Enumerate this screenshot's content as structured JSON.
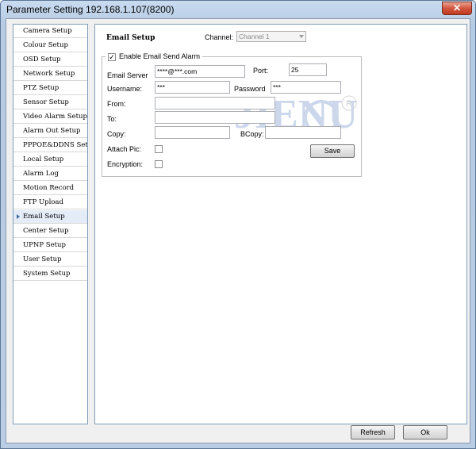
{
  "window": {
    "title": "Parameter Setting 192.168.1.107(8200)",
    "close_glyph": "✕"
  },
  "sidebar": {
    "items": [
      {
        "label": "Camera Setup"
      },
      {
        "label": "Colour Setup"
      },
      {
        "label": "OSD Setup"
      },
      {
        "label": "Network Setup"
      },
      {
        "label": "PTZ Setup"
      },
      {
        "label": "Sensor Setup"
      },
      {
        "label": "Video Alarm Setup"
      },
      {
        "label": "Alarm Out Setup"
      },
      {
        "label": "PPPOE&DDNS Setup"
      },
      {
        "label": "Local Setup"
      },
      {
        "label": "Alarm Log"
      },
      {
        "label": "Motion Record"
      },
      {
        "label": "FTP Upload"
      },
      {
        "label": "Email Setup",
        "active": true
      },
      {
        "label": "Center Setup"
      },
      {
        "label": "UPNP Setup"
      },
      {
        "label": "User Setup"
      },
      {
        "label": "System Setup"
      }
    ]
  },
  "panel": {
    "title": "Email Setup",
    "channel_label": "Channel:",
    "channel_value": "Channel 1",
    "enable_label": "Enable Email Send Alarm",
    "enable_checked": true,
    "email_server_label": "Email Server",
    "email_server_value": "****@***.com",
    "port_label": "Port:",
    "port_value": "25",
    "username_label": "Username:",
    "username_value": "***",
    "password_label": "Password",
    "password_value": "***",
    "from_label": "From:",
    "from_value": "",
    "to_label": "To:",
    "to_value": "",
    "copy_label": "Copy:",
    "copy_value": "",
    "bcopy_label": "BCopy:",
    "bcopy_value": "",
    "attach_label": "Attach Pic:",
    "attach_checked": false,
    "encryption_label": "Encryption:",
    "encryption_checked": false,
    "save_label": "Save"
  },
  "watermark": {
    "text": "JIENU",
    "registered": "R"
  },
  "footer": {
    "refresh_label": "Refresh",
    "ok_label": "Ok"
  },
  "colors": {
    "title_bar": "#c9dbef",
    "close_button": "#c0391f",
    "active_sidebar": "#e4ecf7"
  }
}
